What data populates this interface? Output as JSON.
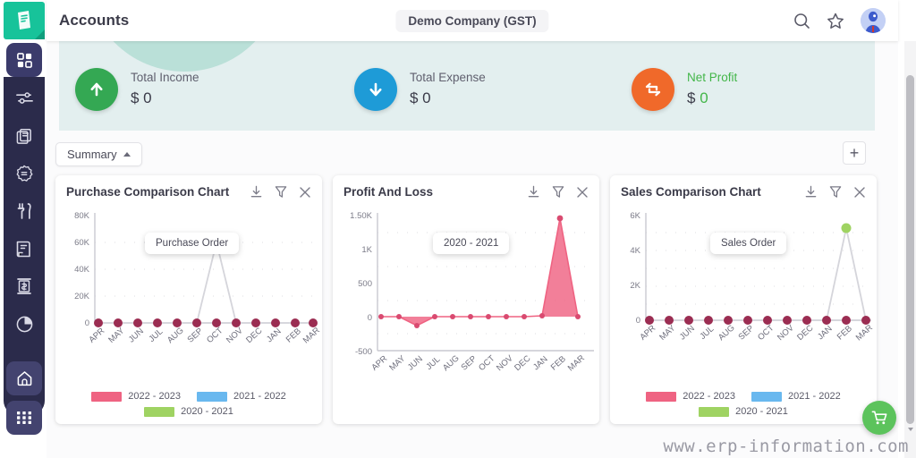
{
  "header": {
    "title": "Accounts",
    "company": "Demo Company (GST)",
    "search_icon": "search-icon",
    "star_icon": "star-icon",
    "avatar": "user-avatar"
  },
  "sidebar": {
    "logo": "erp-logo-icon",
    "items": [
      {
        "name": "dashboard-grid-icon"
      },
      {
        "name": "sliders-icon"
      },
      {
        "name": "documents-icon"
      },
      {
        "name": "settings-gear-icon"
      },
      {
        "name": "tools-icon"
      },
      {
        "name": "report-icon"
      },
      {
        "name": "cash-icon"
      },
      {
        "name": "pie-chart-icon"
      },
      {
        "name": "home-icon"
      },
      {
        "name": "apps-grid-icon"
      }
    ]
  },
  "banner": {
    "cards": [
      {
        "label": "Total Income",
        "value": "$ 0",
        "icon": "arrow-up-icon",
        "color": "#34a853",
        "label_color": "#5f5f6e",
        "value_color": "#3a3a48"
      },
      {
        "label": "Total Expense",
        "value": "$ 0",
        "icon": "arrow-down-icon",
        "color": "#1e9bd7",
        "label_color": "#5f5f6e",
        "value_color": "#3a3a48"
      },
      {
        "label": "Net Profit",
        "value": "$ 0",
        "icon": "exchange-icon",
        "color": "#f0692a",
        "label_color": "#43b649",
        "value_color": "#3a3a48"
      }
    ]
  },
  "toolbar": {
    "summary_label": "Summary",
    "add_label": "+"
  },
  "card_tools": {
    "download": "download-icon",
    "filter": "filter-icon",
    "close": "close-icon"
  },
  "legend": {
    "series": [
      {
        "label": "2022 - 2023",
        "color": "#ef6382"
      },
      {
        "label": "2021 - 2022",
        "color": "#69b8ef"
      },
      {
        "label": "2020 - 2021",
        "color": "#9fd362"
      }
    ]
  },
  "footer": {
    "watermark": "www.erp-information.com",
    "fab_icon": "shopping-cart-icon"
  },
  "chart_data": [
    {
      "type": "line",
      "title": "Purchase Comparison Chart",
      "tooltip": "Purchase Order",
      "categories": [
        "APR",
        "MAY",
        "JUN",
        "JUL",
        "AUG",
        "SEP",
        "OCT",
        "NOV",
        "DEC",
        "JAN",
        "FEB",
        "MAR"
      ],
      "ylim": [
        0,
        80000
      ],
      "yticks": [
        0,
        20000,
        40000,
        60000,
        80000
      ],
      "ytick_labels": [
        "0",
        "20K",
        "40K",
        "60K",
        "80K"
      ],
      "grid": true,
      "legend_position": "bottom",
      "series": [
        {
          "name": "2022 - 2023",
          "color": "#ef6382",
          "values": [
            0,
            0,
            0,
            0,
            0,
            0,
            0,
            0,
            0,
            0,
            0,
            0
          ]
        },
        {
          "name": "2021 - 2022",
          "color": "#69b8ef",
          "values": [
            0,
            0,
            0,
            0,
            0,
            0,
            0,
            0,
            0,
            0,
            0,
            0
          ]
        },
        {
          "name": "2020 - 2021",
          "color": "#9fd362",
          "values": [
            0,
            0,
            0,
            0,
            0,
            0,
            60000,
            0,
            0,
            0,
            0,
            0
          ]
        }
      ]
    },
    {
      "type": "area",
      "title": "Profit And Loss",
      "tooltip": "2020 - 2021",
      "categories": [
        "APR",
        "MAY",
        "JUN",
        "JUL",
        "AUG",
        "SEP",
        "OCT",
        "NOV",
        "DEC",
        "JAN",
        "FEB",
        "MAR"
      ],
      "ylim": [
        -500,
        1500
      ],
      "yticks": [
        -500,
        0,
        500,
        1000,
        1500
      ],
      "ytick_labels": [
        "-500",
        "0",
        "500",
        "1K",
        "1.50K"
      ],
      "grid": true,
      "legend_position": "none",
      "series": [
        {
          "name": "2020 - 2021",
          "color": "#ef6382",
          "values": [
            0,
            0,
            -120,
            0,
            0,
            0,
            0,
            0,
            0,
            0,
            1450,
            0
          ]
        }
      ]
    },
    {
      "type": "line",
      "title": "Sales Comparison Chart",
      "tooltip": "Sales Order",
      "categories": [
        "APR",
        "MAY",
        "JUN",
        "JUL",
        "AUG",
        "SEP",
        "OCT",
        "NOV",
        "DEC",
        "JAN",
        "FEB",
        "MAR"
      ],
      "ylim": [
        0,
        6000
      ],
      "yticks": [
        0,
        2000,
        4000,
        6000
      ],
      "ytick_labels": [
        "0",
        "2K",
        "4K",
        "6K"
      ],
      "grid": true,
      "legend_position": "bottom",
      "series": [
        {
          "name": "2022 - 2023",
          "color": "#ef6382",
          "values": [
            0,
            0,
            0,
            0,
            0,
            0,
            0,
            0,
            0,
            0,
            0,
            0
          ]
        },
        {
          "name": "2021 - 2022",
          "color": "#69b8ef",
          "values": [
            0,
            0,
            0,
            0,
            0,
            0,
            0,
            0,
            0,
            0,
            0,
            0
          ]
        },
        {
          "name": "2020 - 2021",
          "color": "#9fd362",
          "values": [
            0,
            0,
            0,
            0,
            0,
            0,
            0,
            0,
            0,
            0,
            5300,
            0
          ]
        }
      ]
    }
  ]
}
